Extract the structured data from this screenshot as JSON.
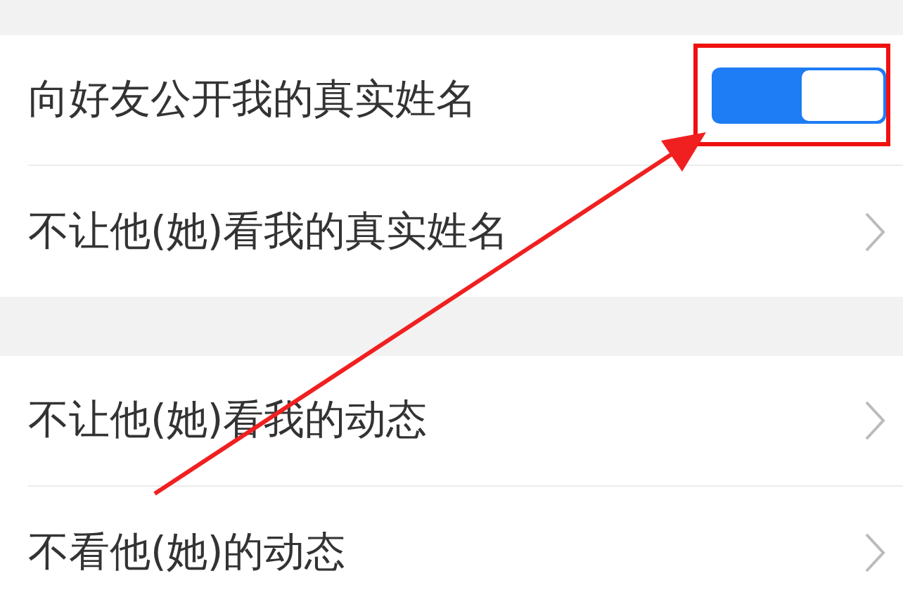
{
  "sections": [
    {
      "rows": [
        {
          "label": "向好友公开我的真实姓名",
          "kind": "toggle",
          "on": true
        },
        {
          "label": "不让他(她)看我的真实姓名",
          "kind": "link"
        }
      ]
    },
    {
      "rows": [
        {
          "label": "不让他(她)看我的动态",
          "kind": "link"
        },
        {
          "label": "不看他(她)的动态",
          "kind": "link"
        }
      ]
    }
  ],
  "annotations": [
    {
      "kind": "highlight-box"
    },
    {
      "kind": "arrow"
    }
  ]
}
